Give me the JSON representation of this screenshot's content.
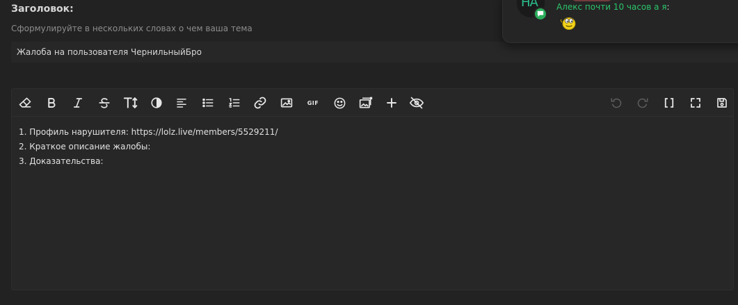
{
  "form": {
    "title_label": "Заголовок:",
    "title_hint": "Сформулируйте в нескольких словах о чем ваша тема",
    "title_value": "Жалоба на пользователя ЧернильныйБро"
  },
  "editor": {
    "lines": [
      "1. Профиль нарушителя: https://lolz.live/members/5529211/",
      "2. Краткое описание жалобы:",
      "3. Доказательства:"
    ],
    "toolbar_left_icons": [
      "eraser-icon",
      "bold-icon",
      "italic-icon",
      "strikethrough-icon",
      "text-size-icon",
      "contrast-icon",
      "align-left-icon",
      "bullet-list-icon",
      "numbered-list-icon",
      "link-icon",
      "image-icon",
      "gif-icon",
      "emoji-icon",
      "gallery-icon",
      "plus-icon",
      "hide-icon"
    ],
    "toolbar_right_icons": [
      "undo-icon",
      "redo-icon",
      "brackets-icon",
      "fullscreen-icon",
      "save-icon"
    ],
    "gif_label": "GIF"
  },
  "notification": {
    "avatar_initials": "НА",
    "message": "Алекс почти 10 часов а я",
    "separator": ":"
  },
  "colors": {
    "background": "#222222",
    "field": "#272727",
    "accent_green": "#2bc46a",
    "text": "#d6d6d6",
    "hint": "#8c8c8c"
  }
}
